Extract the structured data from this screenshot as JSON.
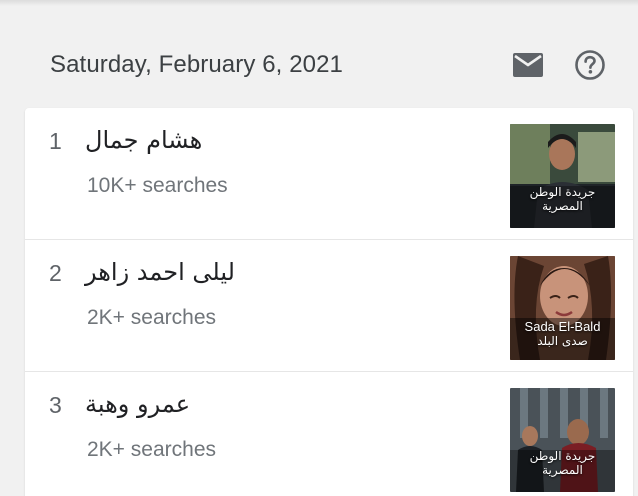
{
  "header": {
    "date": "Saturday, February 6, 2021",
    "mail_icon": "mail-icon",
    "help_icon": "help-circle-icon"
  },
  "colors": {
    "page_bg": "#f1f1f1",
    "card_bg": "#ffffff",
    "text_primary": "#202124",
    "text_secondary": "#70757a",
    "icon": "#5f6368"
  },
  "trends": [
    {
      "rank": "1",
      "query": "هشام جمال",
      "searches": "10K+ searches",
      "thumb_caption_line1": "جريدة الوطن",
      "thumb_caption_line2": "المصرية"
    },
    {
      "rank": "2",
      "query": "ليلى احمد زاهر",
      "searches": "2K+ searches",
      "thumb_caption_line1": "Sada El-Bald",
      "thumb_caption_line2": "صدى البلد"
    },
    {
      "rank": "3",
      "query": "عمرو وهبة",
      "searches": "2K+ searches",
      "thumb_caption_line1": "جريدة الوطن",
      "thumb_caption_line2": "المصرية"
    }
  ]
}
